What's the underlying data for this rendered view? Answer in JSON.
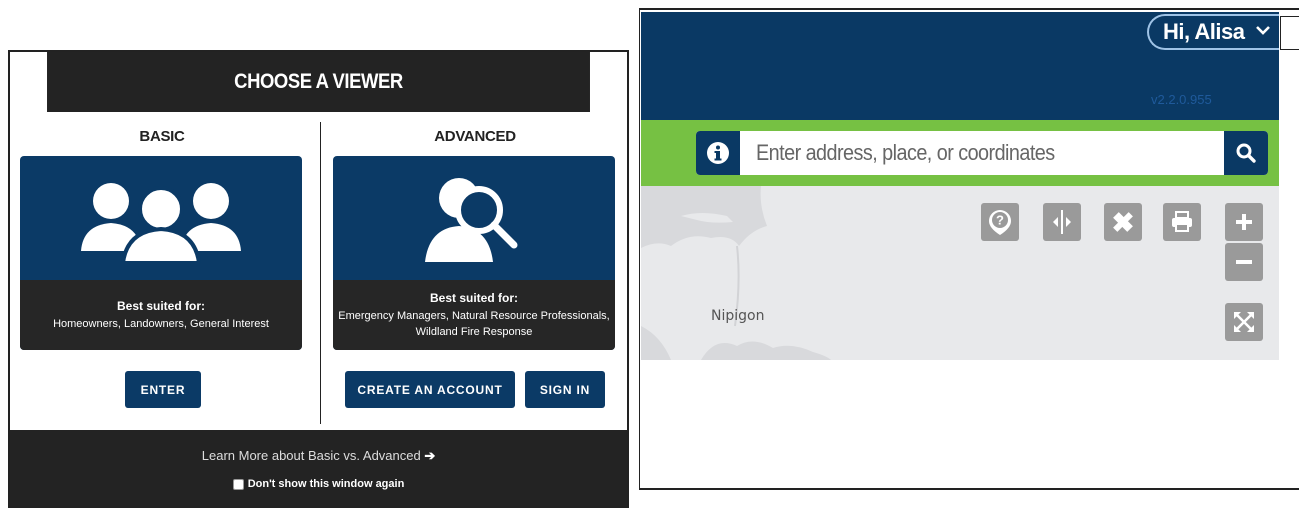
{
  "viewer": {
    "title": "CHOOSE A VIEWER",
    "basic": {
      "title": "BASIC",
      "suited_label": "Best suited for:",
      "suited_text": "Homeowners, Landowners, General Interest",
      "enter_label": "ENTER",
      "icon": "users-group-icon"
    },
    "advanced": {
      "title": "ADVANCED",
      "suited_label": "Best suited for:",
      "suited_line1": "Emergency Managers, Natural Resource Professionals,",
      "suited_line2": "Wildland Fire Response",
      "create_label": "CREATE AN ACCOUNT",
      "signin_label": "SIGN IN",
      "icon": "user-search-icon"
    },
    "footer": {
      "learn_more": "Learn More about Basic vs. Advanced",
      "dont_show": "Don't show this window again"
    }
  },
  "map": {
    "user_greeting": "Hi, Alisa",
    "version": "v2.2.0.955",
    "search_placeholder": "Enter address, place, or coordinates",
    "place_label": "Nipigon",
    "tools": [
      "identify-icon",
      "swipe-icon",
      "measure-icon",
      "print-icon",
      "zoom-in-icon",
      "zoom-out-icon",
      "fullscreen-icon"
    ]
  },
  "colors": {
    "navy": "#0a3964",
    "dark": "#232323",
    "green": "#76c143",
    "tool_gray": "#9a9a9a"
  }
}
